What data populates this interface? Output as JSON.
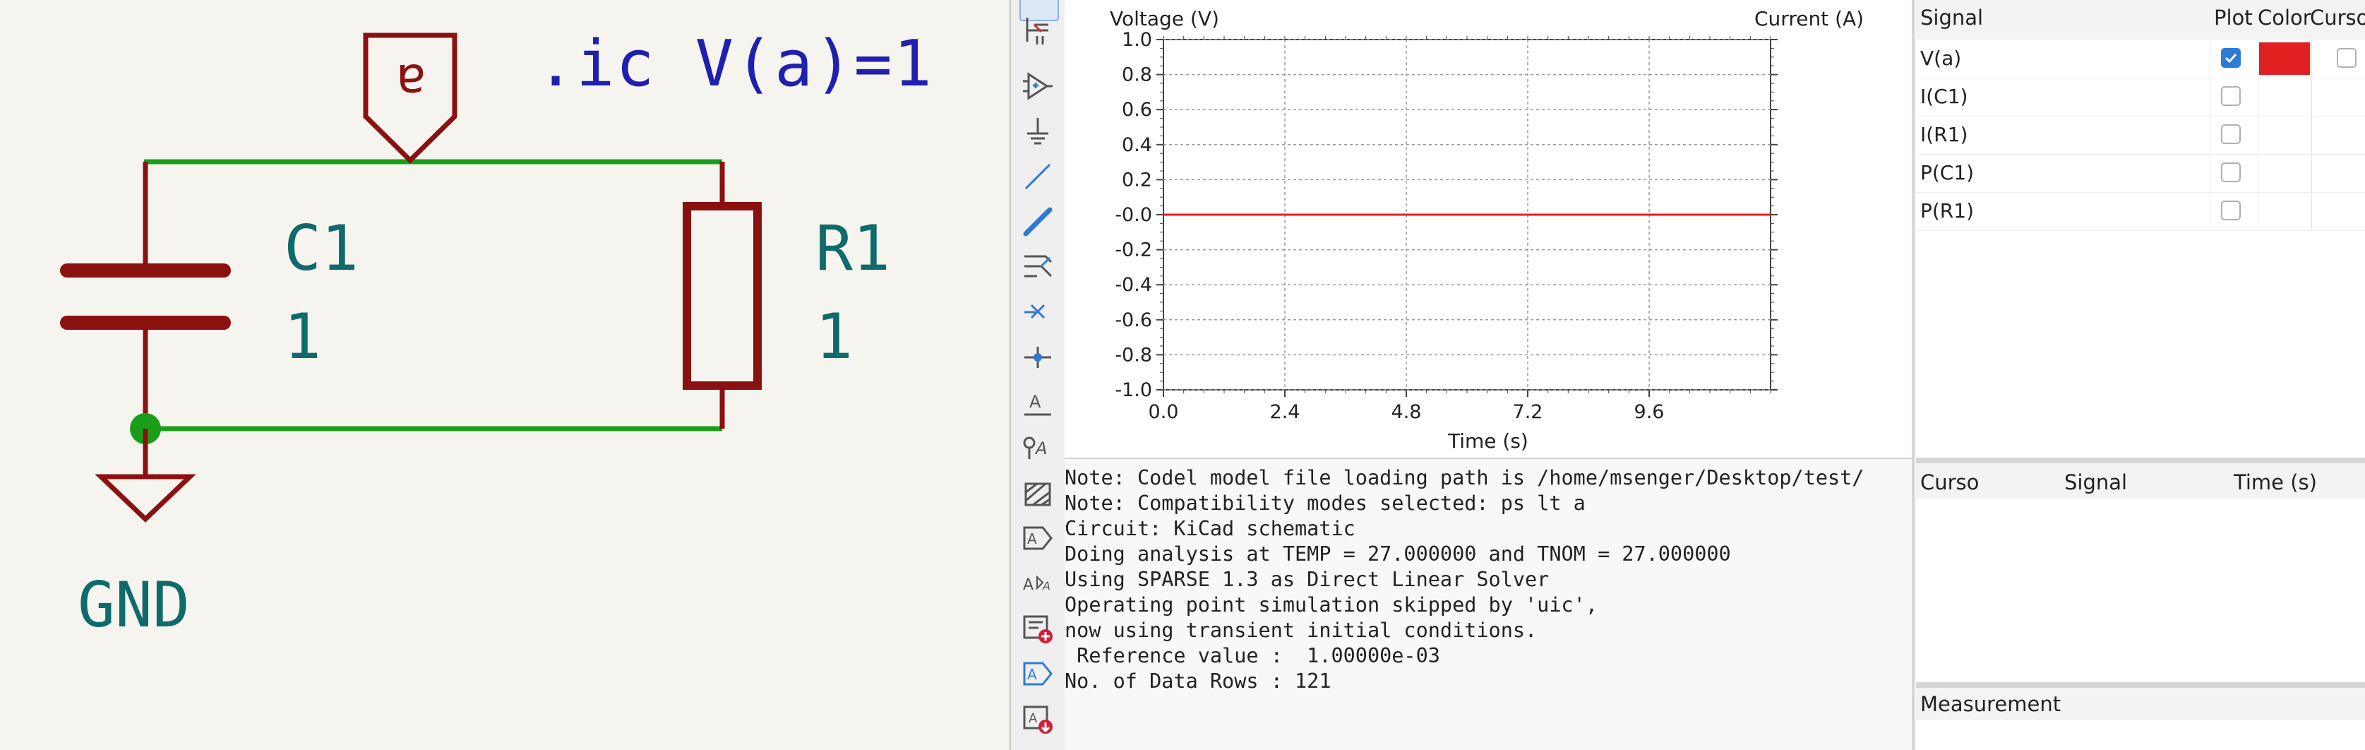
{
  "schematic": {
    "ic_directive": ".ic V(a)=1",
    "net_label": "a",
    "capacitor": {
      "ref": "C1",
      "value": "1"
    },
    "resistor": {
      "ref": "R1",
      "value": "1"
    },
    "ground_label": "GND",
    "colors": {
      "wire": "#1a9e1a",
      "component": "#8b1010",
      "text": "#0f6b6b",
      "directive": "#1f1fb0",
      "junction": "#1a9e1a"
    }
  },
  "toolbar": {
    "icons": [
      "select-icon",
      "bus-entry-icon",
      "add-symbol-icon",
      "add-power-icon",
      "draw-wire-icon",
      "draw-bus-icon",
      "bus-entry-line-icon",
      "no-connect-icon",
      "junction-icon",
      "net-label-icon",
      "global-label-icon",
      "hier-label-icon",
      "hier-sheet-icon",
      "sheet-pin-icon",
      "text-icon",
      "import-sheet-icon",
      "image-icon",
      "export-icon"
    ]
  },
  "plot": {
    "left_axis_title": "Voltage (V)",
    "right_axis_title": "Current (A)",
    "x_axis_title": "Time (s)",
    "y_ticks": [
      "1.0",
      "0.8",
      "0.6",
      "0.4",
      "0.2",
      "-0.0",
      "-0.2",
      "-0.4",
      "-0.6",
      "-0.8",
      "-1.0"
    ],
    "x_ticks": [
      "0.0",
      "2.4",
      "4.8",
      "7.2",
      "9.6"
    ]
  },
  "chart_data": {
    "type": "line",
    "xlabel": "Time (s)",
    "ylabel": "Voltage (V)",
    "y2label": "Current (A)",
    "xlim": [
      0,
      12
    ],
    "ylim": [
      -1.0,
      1.0
    ],
    "grid": true,
    "series": [
      {
        "name": "V(a)",
        "color": "#e02020",
        "x": [
          0,
          12
        ],
        "y": [
          0.0,
          0.0
        ]
      }
    ]
  },
  "console": {
    "lines": [
      "Note: Codel model file loading path is /home/msenger/Desktop/test/",
      "Note: Compatibility modes selected: ps lt a",
      "Circuit: KiCad schematic",
      "Doing analysis at TEMP = 27.000000 and TNOM = 27.000000",
      "Using SPARSE 1.3 as Direct Linear Solver",
      "Operating point simulation skipped by 'uic',",
      "now using transient initial conditions.",
      " Reference value :  1.00000e-03",
      "No. of Data Rows : 121"
    ]
  },
  "signals": {
    "headers": {
      "signal": "Signal",
      "plot": "Plot",
      "color": "Color",
      "cursor": "Curso"
    },
    "rows": [
      {
        "name": "V(a)",
        "plot": true,
        "color": "#e02020"
      },
      {
        "name": "I(C1)",
        "plot": false,
        "color": ""
      },
      {
        "name": "I(R1)",
        "plot": false,
        "color": ""
      },
      {
        "name": "P(C1)",
        "plot": false,
        "color": ""
      },
      {
        "name": "P(R1)",
        "plot": false,
        "color": ""
      }
    ]
  },
  "cursors": {
    "headers": {
      "cursor": "Curso",
      "signal": "Signal",
      "time": "Time (s)"
    }
  },
  "measurements": {
    "header": "Measurement"
  }
}
